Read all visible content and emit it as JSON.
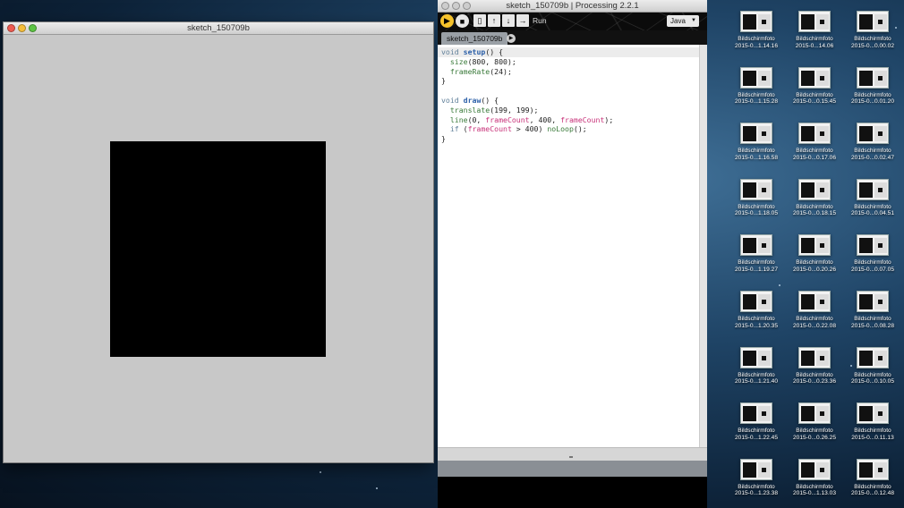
{
  "sketch_window": {
    "title": "sketch_150709b",
    "canvas_color": "#000000",
    "background_color": "#c8c8c8"
  },
  "ide_window": {
    "title": "sketch_150709b | Processing 2.2.1",
    "toolbar": {
      "run_label": "Run",
      "mode": "Java",
      "buttons": [
        "run-icon",
        "stop-icon",
        "new-icon",
        "open-icon",
        "save-icon",
        "export-icon"
      ]
    },
    "tab": {
      "label": "sketch_150709b"
    },
    "code_lines": [
      [
        {
          "t": "void ",
          "c": "kw"
        },
        {
          "t": "setup",
          "c": "fn"
        },
        {
          "t": "() {",
          "c": ""
        }
      ],
      [
        {
          "t": "  ",
          "c": ""
        },
        {
          "t": "size",
          "c": "builtin"
        },
        {
          "t": "(800, 800);",
          "c": ""
        }
      ],
      [
        {
          "t": "  ",
          "c": ""
        },
        {
          "t": "frameRate",
          "c": "builtin"
        },
        {
          "t": "(24);",
          "c": ""
        }
      ],
      [
        {
          "t": "}",
          "c": ""
        }
      ],
      [
        {
          "t": "",
          "c": ""
        }
      ],
      [
        {
          "t": "void ",
          "c": "kw"
        },
        {
          "t": "draw",
          "c": "fn"
        },
        {
          "t": "() {",
          "c": ""
        }
      ],
      [
        {
          "t": "  ",
          "c": ""
        },
        {
          "t": "translate",
          "c": "builtin"
        },
        {
          "t": "(199, 199);",
          "c": ""
        }
      ],
      [
        {
          "t": "  ",
          "c": ""
        },
        {
          "t": "line",
          "c": "builtin"
        },
        {
          "t": "(0, ",
          "c": ""
        },
        {
          "t": "frameCount",
          "c": "var"
        },
        {
          "t": ", 400, ",
          "c": ""
        },
        {
          "t": "frameCount",
          "c": "var"
        },
        {
          "t": ");",
          "c": ""
        }
      ],
      [
        {
          "t": "  ",
          "c": ""
        },
        {
          "t": "if",
          "c": "ctrl"
        },
        {
          "t": " (",
          "c": ""
        },
        {
          "t": "frameCount",
          "c": "var"
        },
        {
          "t": " > 400) ",
          "c": ""
        },
        {
          "t": "noLoop",
          "c": "builtin"
        },
        {
          "t": "();",
          "c": ""
        }
      ],
      [
        {
          "t": "}",
          "c": ""
        }
      ]
    ]
  },
  "desktop_icons": [
    {
      "l1": "Bildschirmfoto",
      "l2": "2015-0...1.14.16"
    },
    {
      "l1": "Bildschirmfoto",
      "l2": "2015-0...14.06"
    },
    {
      "l1": "Bildschirmfoto",
      "l2": "2015-0...0.00.02"
    },
    {
      "l1": "Bildschirmfoto",
      "l2": "2015-0...1.15.28"
    },
    {
      "l1": "Bildschirmfoto",
      "l2": "2015-0...0.15.45"
    },
    {
      "l1": "Bildschirmfoto",
      "l2": "2015-0...0.01.20"
    },
    {
      "l1": "Bildschirmfoto",
      "l2": "2015-0...1.16.58"
    },
    {
      "l1": "Bildschirmfoto",
      "l2": "2015-0...0.17.06"
    },
    {
      "l1": "Bildschirmfoto",
      "l2": "2015-0...0.02.47"
    },
    {
      "l1": "Bildschirmfoto",
      "l2": "2015-0...1.18.05"
    },
    {
      "l1": "Bildschirmfoto",
      "l2": "2015-0...0.18.15"
    },
    {
      "l1": "Bildschirmfoto",
      "l2": "2015-0...0.04.51"
    },
    {
      "l1": "Bildschirmfoto",
      "l2": "2015-0...1.19.27"
    },
    {
      "l1": "Bildschirmfoto",
      "l2": "2015-0...0.20.26"
    },
    {
      "l1": "Bildschirmfoto",
      "l2": "2015-0...0.07.05"
    },
    {
      "l1": "Bildschirmfoto",
      "l2": "2015-0...1.20.35"
    },
    {
      "l1": "Bildschirmfoto",
      "l2": "2015-0...0.22.08"
    },
    {
      "l1": "Bildschirmfoto",
      "l2": "2015-0...0.08.28"
    },
    {
      "l1": "Bildschirmfoto",
      "l2": "2015-0...1.21.40"
    },
    {
      "l1": "Bildschirmfoto",
      "l2": "2015-0...0.23.36"
    },
    {
      "l1": "Bildschirmfoto",
      "l2": "2015-0...0.10.05"
    },
    {
      "l1": "Bildschirmfoto",
      "l2": "2015-0...1.22.45"
    },
    {
      "l1": "Bildschirmfoto",
      "l2": "2015-0...0.26.25"
    },
    {
      "l1": "Bildschirmfoto",
      "l2": "2015-0...0.11.13"
    },
    {
      "l1": "Bildschirmfoto",
      "l2": "2015-0...1.23.38"
    },
    {
      "l1": "Bildschirmfoto",
      "l2": "2015-0...1.13.03"
    },
    {
      "l1": "Bildschirmfoto",
      "l2": "2015-0...0.12.48"
    }
  ]
}
